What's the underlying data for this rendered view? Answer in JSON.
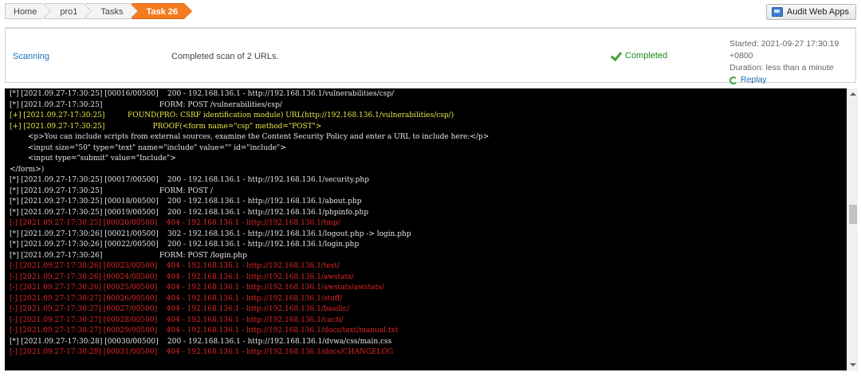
{
  "breadcrumb": [
    "Home",
    "pro1",
    "Tasks",
    "Task 26"
  ],
  "audit_button": "Audit Web Apps",
  "status": {
    "state": "Scanning",
    "message": "Completed scan of 2 URLs.",
    "completed": "Completed",
    "started": "Started: 2021-09-27 17:30:19 +0800",
    "duration": "Duration: less than a minute",
    "replay": "Replay"
  },
  "console": [
    {
      "t": "[*] [2021.09.27-17:30:25] [00016/00500]    200 - 192.168.136.1 - http://192.168.136.1/vulnerabilities/csp/",
      "c": "norm"
    },
    {
      "t": "[*] [2021.09.27-17:30:25]                         FORM: POST /vulnerabilities/csp/",
      "c": "norm"
    },
    {
      "t": "[+] [2021.09.27-17:30:25]          FOUND(PRO: CSRF identification module) URL(http://192.168.136.1/vulnerabilities/csp/)",
      "c": "found"
    },
    {
      "t": "[+] [2021.09.27-17:30:25]                     PROOF(<form name=\"csp\" method=\"POST\">",
      "c": "found"
    },
    {
      "t": "        <p>You can include scripts from external sources, examine the Content Security Policy and enter a URL to include here:</p>",
      "c": "norm"
    },
    {
      "t": "        <input size=\"50\" type=\"text\" name=\"include\" value=\"\" id=\"include\">",
      "c": "norm"
    },
    {
      "t": "        <input type=\"submit\" value=\"Include\">",
      "c": "norm"
    },
    {
      "t": "</form>)",
      "c": "norm"
    },
    {
      "t": "[*] [2021.09.27-17:30:25] [00017/00500]    200 - 192.168.136.1 - http://192.168.136.1/security.php",
      "c": "norm"
    },
    {
      "t": "[*] [2021.09.27-17:30:25]                         FORM: POST /",
      "c": "norm"
    },
    {
      "t": "[*] [2021.09.27-17:30:25] [00018/00500]    200 - 192.168.136.1 - http://192.168.136.1/about.php",
      "c": "norm"
    },
    {
      "t": "[*] [2021.09.27-17:30:25] [00019/00500]    200 - 192.168.136.1 - http://192.168.136.1/phpinfo.php",
      "c": "norm"
    },
    {
      "t": "[-] [2021.09.27-17:30:25] [00020/00500]    404 - 192.168.136.1 - http://192.168.136.1/tmp/",
      "c": "err"
    },
    {
      "t": "[*] [2021.09.27-17:30:26] [00021/00500]    302 - 192.168.136.1 - http://192.168.136.1/logout.php -> login.php",
      "c": "norm"
    },
    {
      "t": "[*] [2021.09.27-17:30:26] [00022/00500]    200 - 192.168.136.1 - http://192.168.136.1/login.php",
      "c": "norm"
    },
    {
      "t": "[*] [2021.09.27-17:30:26]                         FORM: POST /login.php",
      "c": "norm"
    },
    {
      "t": "[-] [2021.09.27-17:30:26] [00023/00500]    404 - 192.168.136.1 - http://192.168.136.1/test/",
      "c": "err"
    },
    {
      "t": "[-] [2021.09.27-17:30:26] [00024/00500]    404 - 192.168.136.1 - http://192.168.136.1/awstats/",
      "c": "err"
    },
    {
      "t": "[-] [2021.09.27-17:30:26] [00025/00500]    404 - 192.168.136.1 - http://192.168.136.1/awstats/awstats/",
      "c": "err"
    },
    {
      "t": "[-] [2021.09.27-17:30:27] [00026/00500]    404 - 192.168.136.1 - http://192.168.136.1/stuff/",
      "c": "err"
    },
    {
      "t": "[-] [2021.09.27-17:30:27] [00027/00500]    404 - 192.168.136.1 - http://192.168.136.1/basilic/",
      "c": "err"
    },
    {
      "t": "[-] [2021.09.27-17:30:27] [00028/00500]    404 - 192.168.136.1 - http://192.168.136.1/cacti/",
      "c": "err"
    },
    {
      "t": "[-] [2021.09.27-17:30:27] [00029/00500]    404 - 192.168.136.1 - http://192.168.136.1/docs/text/manual.txt",
      "c": "err"
    },
    {
      "t": "[*] [2021.09.27-17:30:28] [00030/00500]    200 - 192.168.136.1 - http://192.168.136.1/dvwa/css/main.css",
      "c": "norm"
    },
    {
      "t": "[-] [2021.09.27-17:30:28] [00031/00500]    404 - 192.168.136.1 - http://192.168.136.1/docs/CHANGELOG",
      "c": "err"
    }
  ]
}
